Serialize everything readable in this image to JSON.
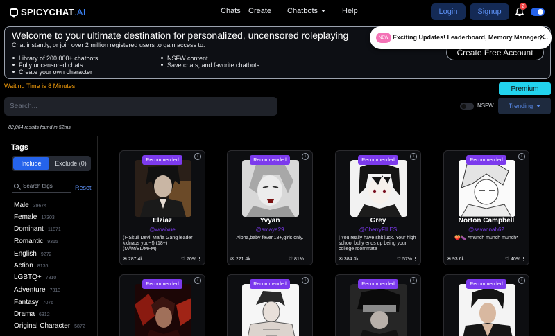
{
  "header": {
    "logo_main": "SPICYCHAT",
    "logo_suffix": ".AI",
    "nav": {
      "chats": "Chats",
      "create": "Create",
      "chatbots": "Chatbots",
      "help": "Help"
    },
    "login": "Login",
    "signup": "Signup",
    "notification_count": "2"
  },
  "banner": {
    "title": "Welcome to your ultimate destination for personalized, uncensored roleplaying",
    "subtitle": "Chat instantly, or join over 2 million registered users to gain access to:",
    "features_left": [
      "Library of 200,000+ chatbots",
      "Fully uncensored chats",
      "Create your own character"
    ],
    "features_right": [
      "NSFW content",
      "Save chats, and favorite chatbots"
    ],
    "cta": "Create Free Account"
  },
  "toast": {
    "badge": "NEW",
    "text": "Exciting Updates! Leaderboard, Memory Manager, ...",
    "close": "✕"
  },
  "waiting": "Waiting Time is 8 Minutes",
  "premium": "Premium",
  "search": {
    "placeholder": "Search..."
  },
  "nsfw_label": "NSFW",
  "sort": "Trending",
  "results": "82,064 results found in 52ms",
  "sidebar": {
    "title": "Tags",
    "include": "Include",
    "exclude": "Exclude (0)",
    "search_placeholder": "Search tags",
    "reset": "Reset",
    "tags": [
      {
        "name": "Male",
        "count": "39674"
      },
      {
        "name": "Female",
        "count": "17303"
      },
      {
        "name": "Dominant",
        "count": "11871"
      },
      {
        "name": "Romantic",
        "count": "9315"
      },
      {
        "name": "English",
        "count": "9272"
      },
      {
        "name": "Action",
        "count": "8136"
      },
      {
        "name": "LGBTQ+",
        "count": "7810"
      },
      {
        "name": "Adventure",
        "count": "7313"
      },
      {
        "name": "Fantasy",
        "count": "7076"
      },
      {
        "name": "Drama",
        "count": "6312"
      },
      {
        "name": "Original Character",
        "count": "5872"
      }
    ]
  },
  "cards": [
    {
      "badge": "Recommended",
      "name": "Elziaz",
      "handle": "@woaixue",
      "desc": "(!~Skull Devil Mafia Gang leader kidnaps you~!) (18+) (M//M/BL/MFM)",
      "chats": "287.4k",
      "rating": "70%"
    },
    {
      "badge": "Recommended",
      "name": "Yvyan",
      "handle": "@amaya29",
      "desc": "Alpha,baby fever,18+,girls only.",
      "chats": "221.4k",
      "rating": "81%"
    },
    {
      "badge": "Recommended",
      "name": "Grey",
      "handle": "@CherryFILES",
      "desc": "| You really have shit luck. Your high school bully ends up being your college roommate",
      "chats": "384.3k",
      "rating": "57%"
    },
    {
      "badge": "Recommended",
      "name": "Norton Campbell",
      "handle": "@savannah62",
      "desc": "🍑🍆 *munch munch munch*",
      "chats": "93.6k",
      "rating": "40%"
    },
    {
      "badge": "Recommended"
    },
    {
      "badge": "Recommended"
    },
    {
      "badge": "Recommended"
    },
    {
      "badge": "Recommended"
    }
  ],
  "colors": {
    "accent": "#2563eb",
    "badge": "#7c3aed",
    "premium": "#22d3ee",
    "waiting": "#f59e0b"
  },
  "icons": [
    "chat-bubble-icon",
    "chevron-down-icon",
    "bell-icon",
    "toggle-icon",
    "close-icon",
    "search-icon",
    "info-icon",
    "message-icon",
    "heart-icon",
    "more-icon"
  ]
}
